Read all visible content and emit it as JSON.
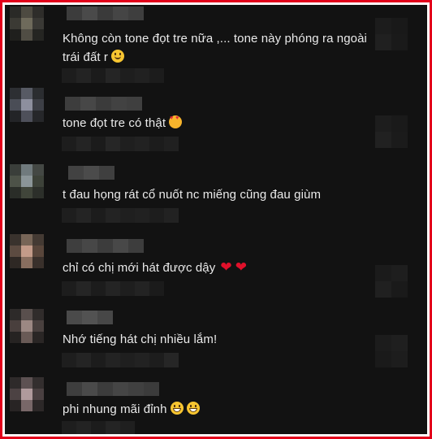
{
  "comments": [
    {
      "text": "Không còn tone đọt tre nữa ,... tone này phóng ra ngoài trái đất r",
      "emoji": [
        "slightly-smiling-face-icon"
      ]
    },
    {
      "text": "tone đọt tre có thật",
      "emoji": [
        "smiling-face-with-hearts-icon"
      ]
    },
    {
      "text": "t đau họng rát cổ nuốt nc miếng cũng đau giùm",
      "emoji": []
    },
    {
      "text": "chỉ có chị mới hát được dậy",
      "emoji": [
        "red-heart-icon",
        "red-heart-icon"
      ]
    },
    {
      "text": "Nhớ tiếng hát chị nhiều lắm!",
      "emoji": []
    },
    {
      "text": "phi nhung mãi đỉnh",
      "emoji": [
        "grinning-face-icon",
        "grinning-face-icon"
      ]
    }
  ],
  "colors": {
    "border": "#e3001b",
    "background": "#121212",
    "text": "#eaeaea",
    "heart": "#e0102a"
  }
}
